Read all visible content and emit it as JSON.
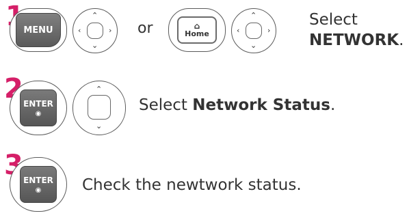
{
  "steps": [
    {
      "number": "1",
      "menu_label": "MENU",
      "or_label": "or",
      "home_label": "Home",
      "instruction_prefix": "Select",
      "instruction_target": "NETWORK",
      "instruction_suffix": "."
    },
    {
      "number": "2",
      "enter_label": "ENTER",
      "enter_dot": "◉",
      "instruction_prefix": "Select ",
      "instruction_target": "Network Status",
      "instruction_suffix": "."
    },
    {
      "number": "3",
      "enter_label": "ENTER",
      "enter_dot": "◉",
      "instruction_text": "Check the newtwork status."
    }
  ],
  "colors": {
    "step_number": "#d51f68",
    "button_dark": "#6a6a6a",
    "text": "#333333"
  },
  "icons": [
    "menu-button",
    "home-button",
    "enter-button",
    "four-way-nav-icon",
    "up-down-nav-icon"
  ]
}
